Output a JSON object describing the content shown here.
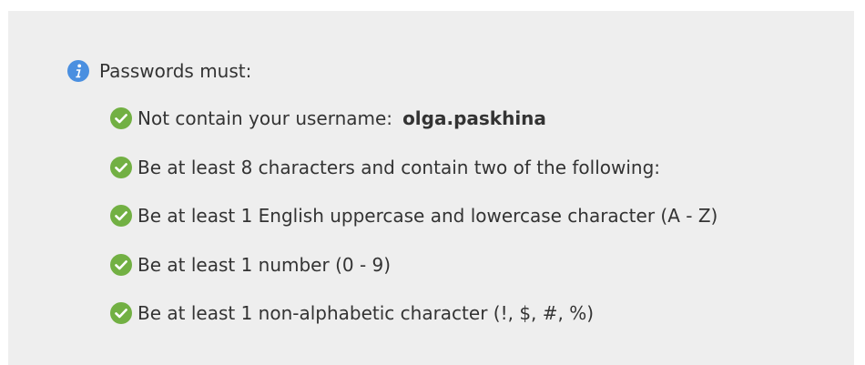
{
  "policy": {
    "header": "Passwords must:",
    "header_icon": "info-icon",
    "username_label": "Not contain your username:",
    "username": "olga.paskhina",
    "rules": [
      "Be at least 8 characters and contain two of the following:",
      "Be at least 1 English uppercase and lowercase character (A - Z)",
      "Be at least 1 number (0 - 9)",
      "Be at least 1 non-alphabetic character (!, $, #, %)"
    ],
    "rule_icon": "check-circle-icon",
    "rule_status": [
      "met",
      "met",
      "met",
      "met",
      "met"
    ]
  },
  "colors": {
    "panel_background": "#eeeeee",
    "text": "#333333",
    "info_icon": "#4a8fe0",
    "check_icon": "#72b043"
  }
}
